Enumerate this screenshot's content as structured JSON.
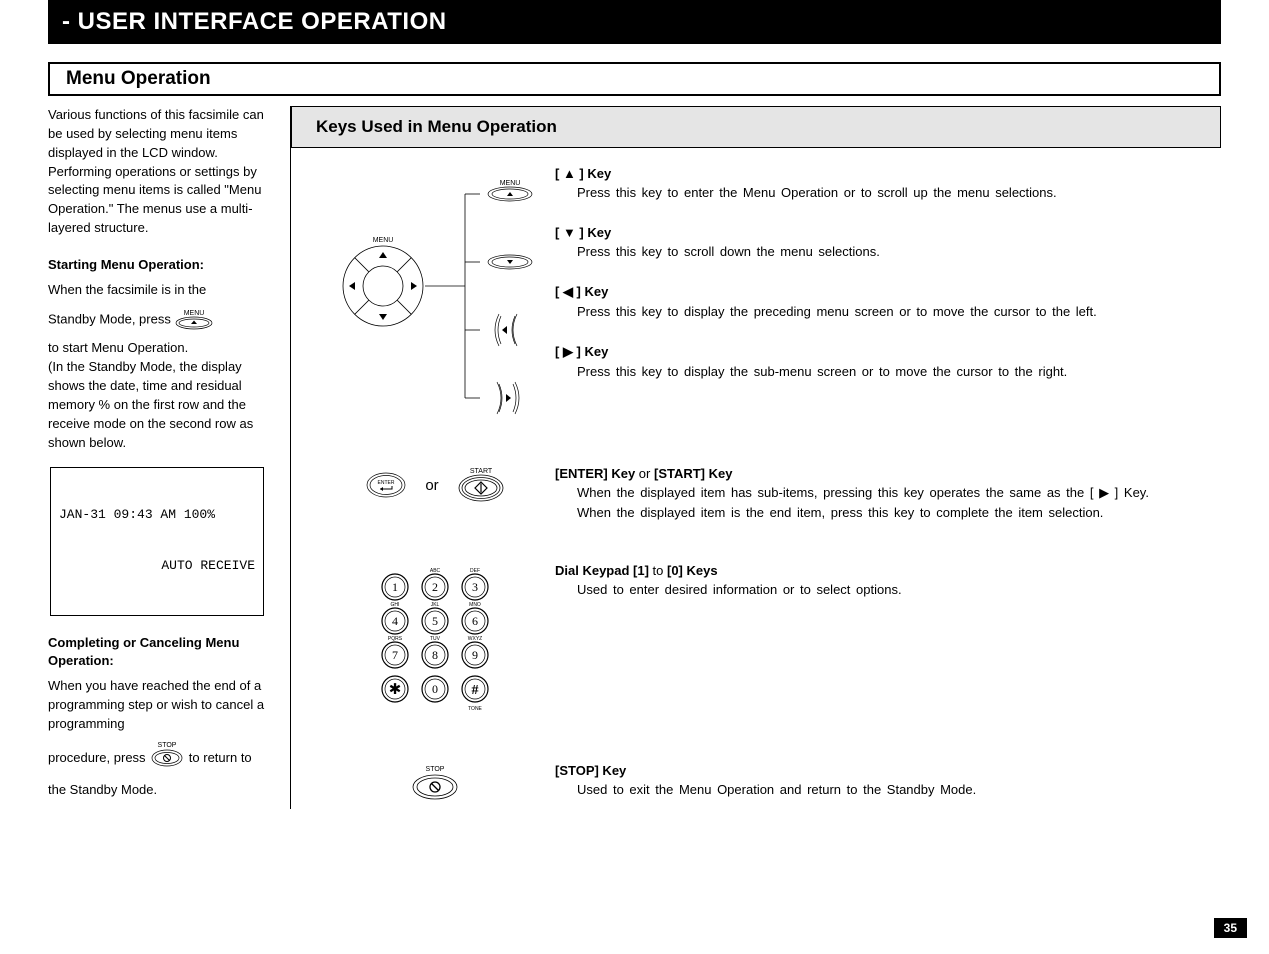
{
  "title": "- USER INTERFACE OPERATION",
  "section": "Menu  Operation",
  "intro": "Various functions of this facsimile can be used by selecting menu items displayed in the LCD window. Performing operations or settings by selecting menu items is called \"Menu Operation.\" The menus use a multi-layered  structure.",
  "starting_head": "Starting Menu Operation:",
  "starting_1": "When the facsimile is in the",
  "starting_2a": "Standby Mode, press ",
  "starting_3": "to start Menu Operation.\n(In the Standby Mode, the display shows the date, time and residual memory % on the first row and the receive mode on the second row as shown below.",
  "lcd_line1": "JAN-31 09:43 AM 100%",
  "lcd_line2": "AUTO RECEIVE",
  "completing_head": "Completing or Canceling Menu Operation:",
  "completing_1": "When you have reached the end of a programming step or wish to cancel a programming",
  "completing_2a": "procedure, press ",
  "completing_2b": " to return to the Standby Mode.",
  "keys_head": "Keys Used in Menu Operation",
  "keys": {
    "up_name": "[ ▲ ] Key",
    "up_txt": "Press this key to enter the Menu Operation or to scroll up the menu selections.",
    "down_name": "[ ▼ ] Key",
    "down_txt": "Press this key to scroll down the menu selections.",
    "left_name": "[ ◀ ] Key",
    "left_txt": "Press this key to display the preceding menu screen or to move the cursor to the left.",
    "right_name": "[ ▶ ] Key",
    "right_txt": "Press this key to display the sub-menu screen or to move the cursor to the right.",
    "enter_name_1": "[ENTER] Key",
    "enter_or": " or ",
    "enter_name_2": "[START] Key",
    "enter_txt": "When the displayed item has sub-items, pressing this key operates the same as the  [ ▶ ] Key.\nWhen the displayed item is the end item, press this key to complete the item selection.",
    "dial_name_1": "Dial Keypad [1]",
    "dial_to": " to ",
    "dial_name_2": "[0] Keys",
    "dial_txt": "Used to enter desired information or to select options.",
    "stop_name": "[STOP] Key",
    "stop_txt": "Used to exit the Menu Operation and return to the Standby Mode."
  },
  "or": "or",
  "page_num": "35",
  "icon_labels": {
    "menu": "MENU",
    "start": "START",
    "stop": "STOP",
    "enter": "ENTER",
    "tone": "TONE"
  }
}
